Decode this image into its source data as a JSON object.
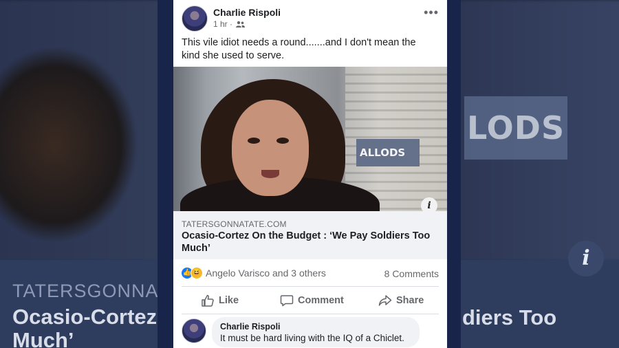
{
  "post": {
    "author": "Charlie Rispoli",
    "time": "1 hr",
    "text": "This vile idiot needs a round.......and I don't mean the kind she used to serve.",
    "more_icon": "more-horizontal-icon",
    "image": {
      "watermark": "ALLODS",
      "info_icon": "i"
    },
    "link": {
      "domain": "TATERSGONNATATE.COM",
      "title": "Ocasio-Cortez On the Budget : ‘We Pay Soldiers Too Much’"
    },
    "reactions": {
      "text": "Angelo Varisco and 3 others",
      "types": [
        "like",
        "haha"
      ]
    },
    "comments_count": "8 Comments",
    "actions": {
      "like": "Like",
      "comment": "Comment",
      "share": "Share"
    }
  },
  "comment": {
    "author": "Charlie Rispoli",
    "text": "It must be hard living with the IQ of a Chiclet."
  },
  "background": {
    "site": "TATERSGONNATA",
    "headline_left": "Ocasio-Cortez",
    "headline_left_2": "Much’",
    "headline_right": "diers Too",
    "logo": "LODS"
  },
  "colors": {
    "facebook_blue": "#1877f2",
    "card_frame": "#19244a",
    "muted_text": "#65676b"
  }
}
